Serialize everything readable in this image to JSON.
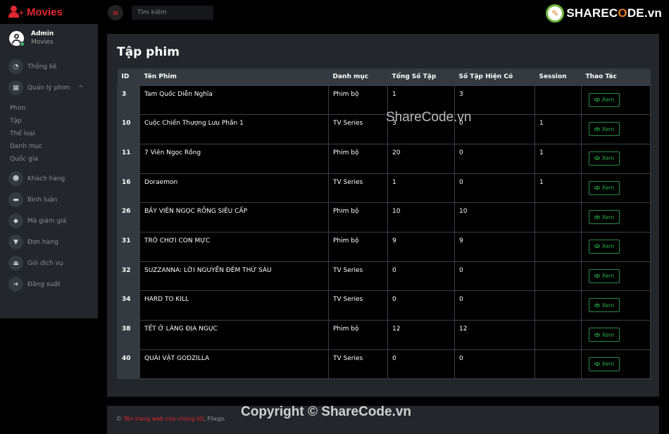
{
  "brand": {
    "name": "Movies"
  },
  "user": {
    "name": "Admin",
    "role": "Movies"
  },
  "sidebar": {
    "items": [
      {
        "label": "Thống kê",
        "icon": "dashboard-icon"
      },
      {
        "label": "Quản lý phim",
        "icon": "film-icon"
      },
      {
        "label": "Khách hàng",
        "icon": "users-icon"
      },
      {
        "label": "Bình luận",
        "icon": "comments-icon"
      },
      {
        "label": "Mã giảm giá",
        "icon": "tags-icon"
      },
      {
        "label": "Đơn hàng",
        "icon": "cart-icon"
      },
      {
        "label": "Gói dịch vụ",
        "icon": "eject-icon"
      },
      {
        "label": "Đăng xuất",
        "icon": "logout-icon"
      }
    ],
    "sub_items": [
      "Phim",
      "Tập",
      "Thể loại",
      "Danh mục",
      "Quốc gia"
    ]
  },
  "topbar": {
    "search_placeholder": "Tìm kiếm"
  },
  "logo": {
    "prefix": "SHAREC",
    "o": "O",
    "suffix": "DE.vn"
  },
  "main": {
    "title": "Tập phim",
    "columns": [
      "ID",
      "Tên Phim",
      "Danh mục",
      "Tổng Số Tập",
      "Số Tập Hiện Có",
      "Session",
      "Thao Tác"
    ],
    "rows": [
      {
        "id": "3",
        "name": "Tam Quốc Diễn Nghĩa",
        "category": "Phim bộ",
        "total": "1",
        "current": "3",
        "session": "",
        "action": "Xem"
      },
      {
        "id": "10",
        "name": "Cuộc Chiến Thượng Lưu Phần 1",
        "category": "TV Series",
        "total": "3",
        "current": "0",
        "session": "1",
        "action": "Xem"
      },
      {
        "id": "11",
        "name": "7 Viên Ngọc Rồng",
        "category": "Phim bộ",
        "total": "20",
        "current": "0",
        "session": "1",
        "action": "Xem"
      },
      {
        "id": "16",
        "name": "Doraemon",
        "category": "TV Series",
        "total": "1",
        "current": "0",
        "session": "1",
        "action": "Xem"
      },
      {
        "id": "26",
        "name": "BẢY VIÊN NGỌC RỒNG SIÊU CẤP",
        "category": "Phim bộ",
        "total": "10",
        "current": "10",
        "session": "",
        "action": "Xem"
      },
      {
        "id": "31",
        "name": "TRÒ CHƠI CON MỰC",
        "category": "Phim bộ",
        "total": "9",
        "current": "9",
        "session": "",
        "action": "Xem"
      },
      {
        "id": "32",
        "name": "SUZZANNA: LỜI NGUYỀN ĐÊM THỨ SÁU",
        "category": "TV Series",
        "total": "0",
        "current": "0",
        "session": "",
        "action": "Xem"
      },
      {
        "id": "34",
        "name": "HARD TO KILL",
        "category": "TV Series",
        "total": "0",
        "current": "0",
        "session": "",
        "action": "Xem"
      },
      {
        "id": "38",
        "name": "TẾT Ở LÀNG ĐỊA NGỤC",
        "category": "Phim bộ",
        "total": "12",
        "current": "12",
        "session": "",
        "action": "Xem"
      },
      {
        "id": "40",
        "name": "QUÁI VẬT GODZILLA",
        "category": "TV Series",
        "total": "0",
        "current": "0",
        "session": "",
        "action": "Xem"
      }
    ]
  },
  "watermark": "ShareCode.vn",
  "footer": {
    "prefix": "© ",
    "link": "Tên trang web của chúng tôi",
    "suffix": ", Flixgo."
  },
  "copyright": "Copyright © ShareCode.vn"
}
